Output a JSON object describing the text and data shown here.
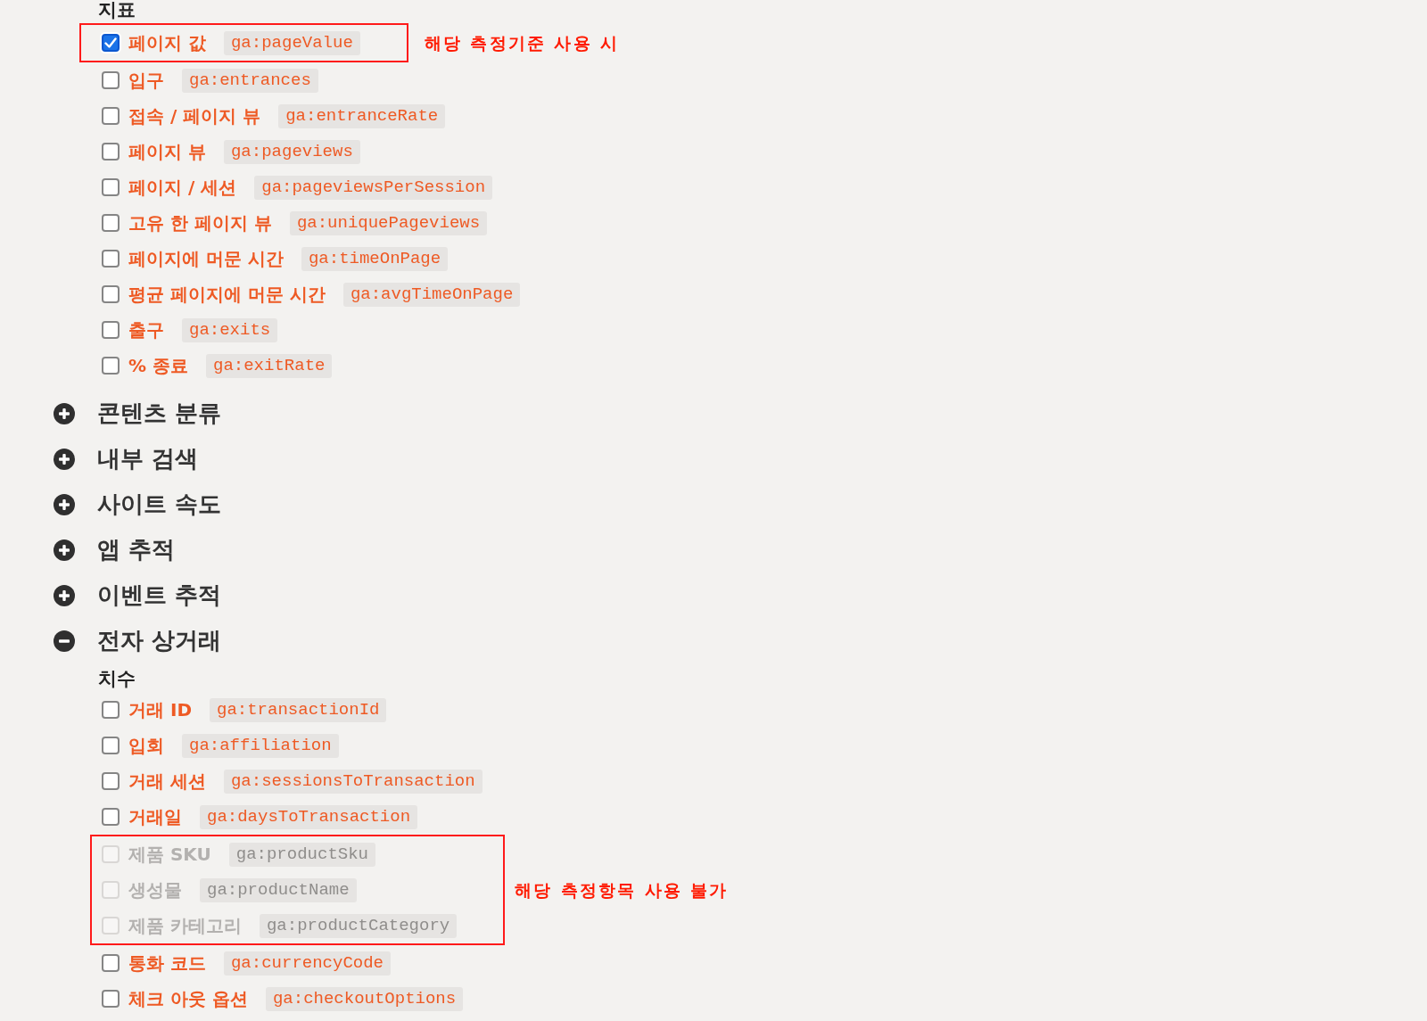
{
  "groups": [
    {
      "heading": "지표",
      "entries": [
        {
          "kind": "callout",
          "note": "해당 측정기준 사용 시",
          "entries": [
            {
              "kind": "metric",
              "label": "페이지 값",
              "code": "ga:pageValue",
              "checked": true,
              "disabled": false
            }
          ]
        },
        {
          "kind": "metric",
          "label": "입구",
          "code": "ga:entrances",
          "checked": false,
          "disabled": false
        },
        {
          "kind": "metric",
          "label": "접속 / 페이지 뷰",
          "code": "ga:entranceRate",
          "checked": false,
          "disabled": false
        },
        {
          "kind": "metric",
          "label": "페이지 뷰",
          "code": "ga:pageviews",
          "checked": false,
          "disabled": false
        },
        {
          "kind": "metric",
          "label": "페이지 / 세션",
          "code": "ga:pageviewsPerSession",
          "checked": false,
          "disabled": false
        },
        {
          "kind": "metric",
          "label": "고유 한 페이지 뷰",
          "code": "ga:uniquePageviews",
          "checked": false,
          "disabled": false
        },
        {
          "kind": "metric",
          "label": "페이지에 머문 시간",
          "code": "ga:timeOnPage",
          "checked": false,
          "disabled": false
        },
        {
          "kind": "metric",
          "label": "평균 페이지에 머문 시간",
          "code": "ga:avgTimeOnPage",
          "checked": false,
          "disabled": false
        },
        {
          "kind": "metric",
          "label": "출구",
          "code": "ga:exits",
          "checked": false,
          "disabled": false
        },
        {
          "kind": "metric",
          "label": "% 종료",
          "code": "ga:exitRate",
          "checked": false,
          "disabled": false
        }
      ]
    }
  ],
  "sections": [
    {
      "title": "콘텐츠 분류",
      "expanded": false
    },
    {
      "title": "내부 검색",
      "expanded": false
    },
    {
      "title": "사이트 속도",
      "expanded": false
    },
    {
      "title": "앱 추적",
      "expanded": false
    },
    {
      "title": "이벤트 추적",
      "expanded": false
    },
    {
      "title": "전자 상거래",
      "expanded": true,
      "groups": [
        {
          "heading": "치수",
          "entries": [
            {
              "kind": "metric",
              "label": "거래 ID",
              "code": "ga:transactionId",
              "checked": false,
              "disabled": false
            },
            {
              "kind": "metric",
              "label": "입회",
              "code": "ga:affiliation",
              "checked": false,
              "disabled": false
            },
            {
              "kind": "metric",
              "label": "거래 세션",
              "code": "ga:sessionsToTransaction",
              "checked": false,
              "disabled": false
            },
            {
              "kind": "metric",
              "label": "거래일",
              "code": "ga:daysToTransaction",
              "checked": false,
              "disabled": false
            },
            {
              "kind": "callout",
              "note": "해당 측정항목 사용 불가",
              "entries": [
                {
                  "kind": "metric",
                  "label": "제품 SKU",
                  "code": "ga:productSku",
                  "checked": false,
                  "disabled": true
                },
                {
                  "kind": "metric",
                  "label": "생성물",
                  "code": "ga:productName",
                  "checked": false,
                  "disabled": true
                },
                {
                  "kind": "metric",
                  "label": "제품 카테고리",
                  "code": "ga:productCategory",
                  "checked": false,
                  "disabled": true
                }
              ]
            },
            {
              "kind": "metric",
              "label": "통화 코드",
              "code": "ga:currencyCode",
              "checked": false,
              "disabled": false
            },
            {
              "kind": "metric",
              "label": "체크 아웃 옵션",
              "code": "ga:checkoutOptions",
              "checked": false,
              "disabled": false
            }
          ]
        }
      ]
    }
  ]
}
